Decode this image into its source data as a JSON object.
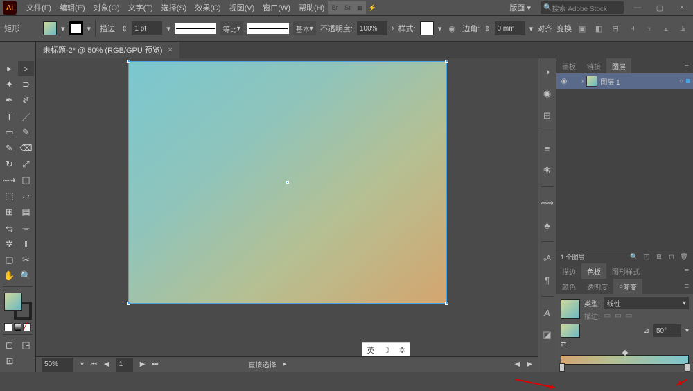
{
  "app": {
    "id": "Ai"
  },
  "menu": {
    "file": "文件(F)",
    "edit": "编辑(E)",
    "object": "对象(O)",
    "type": "文字(T)",
    "select": "选择(S)",
    "effect": "效果(C)",
    "view": "视图(V)",
    "window": "窗口(W)",
    "help": "帮助(H)",
    "br": "Br",
    "st": "St",
    "layout": "版面",
    "search_placeholder": "搜索 Adobe Stock"
  },
  "control": {
    "shape": "矩形",
    "stroke_label": "描边:",
    "stroke_weight": "1 pt",
    "uniform": "等比",
    "basic": "基本",
    "opacity_label": "不透明度:",
    "opacity": "100%",
    "style_label": "样式:",
    "corner_label": "边角:",
    "corner": "0 mm",
    "align": "对齐",
    "transform": "变换"
  },
  "doc": {
    "tab": "未标题-2* @ 50% (RGB/GPU 预览)",
    "close": "×"
  },
  "status": {
    "zoom": "50%",
    "page": "1",
    "tool": "直接选择",
    "ime": "英",
    "moon": "☽",
    "gear": "✲"
  },
  "panels": {
    "artboards": "画板",
    "links": "链接",
    "layers": "图层",
    "layer1": "图层 1",
    "layer_count": "1 个图层",
    "stroke_tab": "描边",
    "swatches_tab": "色板",
    "graphic_styles_tab": "图形样式",
    "color_tab": "颜色",
    "transparency_tab": "透明度",
    "gradient_tab": "渐变"
  },
  "gradient": {
    "type_label": "类型:",
    "type_value": "线性",
    "stroke_label": "描边:",
    "angle": "50°",
    "angle_icon": "⊿"
  },
  "chart_data": {
    "type": "gradient",
    "gradient_type": "linear",
    "angle_deg": 50,
    "stops": [
      {
        "position": 0,
        "color": "#d4a56f"
      },
      {
        "position": 100,
        "color": "#7ac7d0"
      }
    ],
    "midpoints": [
      50
    ]
  }
}
